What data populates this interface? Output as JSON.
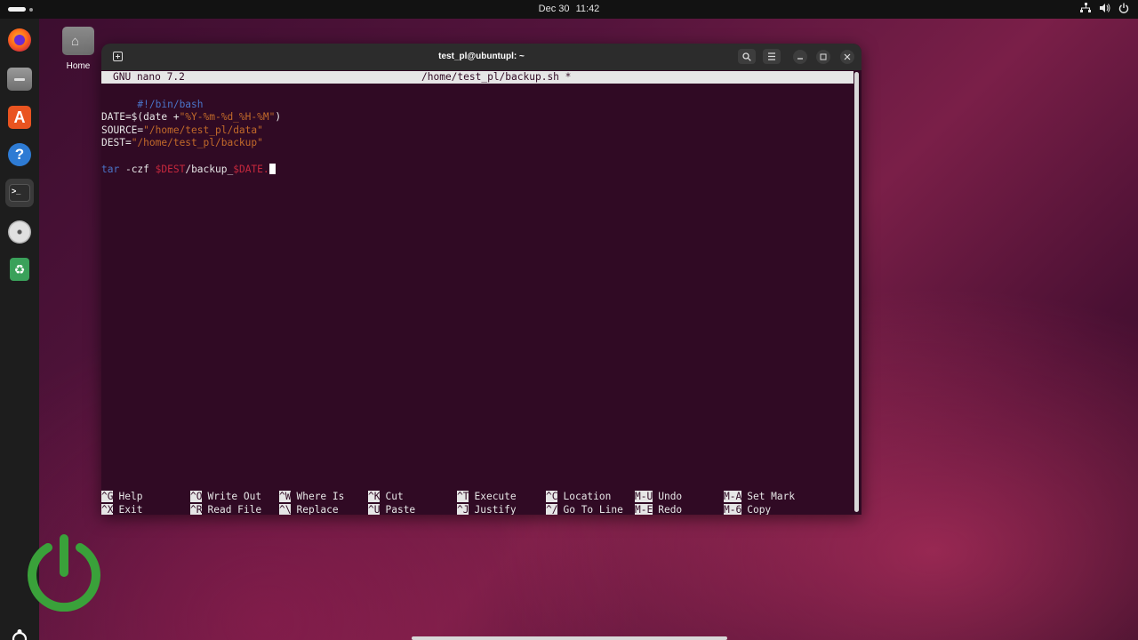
{
  "topbar": {
    "date": "Dec 30",
    "time": "11:42",
    "tray_icons": [
      "network-icon",
      "volume-icon",
      "power-icon"
    ]
  },
  "dock": {
    "items": [
      {
        "name": "firefox",
        "color": "#e66000"
      },
      {
        "name": "files",
        "color": "#8a8a8a"
      },
      {
        "name": "app-center",
        "color": "#e95420"
      },
      {
        "name": "help",
        "color": "#2e7bd4"
      },
      {
        "name": "terminal",
        "color": "#2c2c2c"
      },
      {
        "name": "disc",
        "color": "#cfcfcf"
      },
      {
        "name": "trash",
        "color": "#3aa15a"
      }
    ]
  },
  "desktop": {
    "home_label": "Home"
  },
  "window": {
    "title": "test_pl@ubuntupl: ~"
  },
  "nano": {
    "version": "GNU nano 7.2",
    "filename": "/home/test_pl/backup.sh *",
    "lines": {
      "shebang": "#!/bin/bash",
      "date_prefix": "DATE=$(date +",
      "date_format": "\"%Y-%m-%d_%H-%M\"",
      "date_suffix": ")",
      "source_prefix": "SOURCE=",
      "source_value": "\"/home/test_pl/data\"",
      "dest_prefix": "DEST=",
      "dest_value": "\"/home/test_pl/backup\"",
      "tar_cmd": "tar",
      "tar_flags": " -czf ",
      "tar_dest_var": "$DEST",
      "tar_path": "/backup_",
      "tar_date_var": "$DATE",
      "tar_tail": "."
    },
    "shortcuts": [
      [
        {
          "key": "^G",
          "label": "Help"
        },
        {
          "key": "^X",
          "label": "Exit"
        }
      ],
      [
        {
          "key": "^O",
          "label": "Write Out"
        },
        {
          "key": "^R",
          "label": "Read File"
        }
      ],
      [
        {
          "key": "^W",
          "label": "Where Is"
        },
        {
          "key": "^\\",
          "label": "Replace"
        }
      ],
      [
        {
          "key": "^K",
          "label": "Cut"
        },
        {
          "key": "^U",
          "label": "Paste"
        }
      ],
      [
        {
          "key": "^T",
          "label": "Execute"
        },
        {
          "key": "^J",
          "label": "Justify"
        }
      ],
      [
        {
          "key": "^C",
          "label": "Location"
        },
        {
          "key": "^/",
          "label": "Go To Line"
        }
      ],
      [
        {
          "key": "M-U",
          "label": "Undo"
        },
        {
          "key": "M-E",
          "label": "Redo"
        }
      ],
      [
        {
          "key": "M-A",
          "label": "Set Mark"
        },
        {
          "key": "M-6",
          "label": "Copy"
        }
      ]
    ]
  },
  "colors": {
    "terminal_bg": "#300a24",
    "accent_orange": "#e95420",
    "power_logo_green": "#3aa13a"
  }
}
